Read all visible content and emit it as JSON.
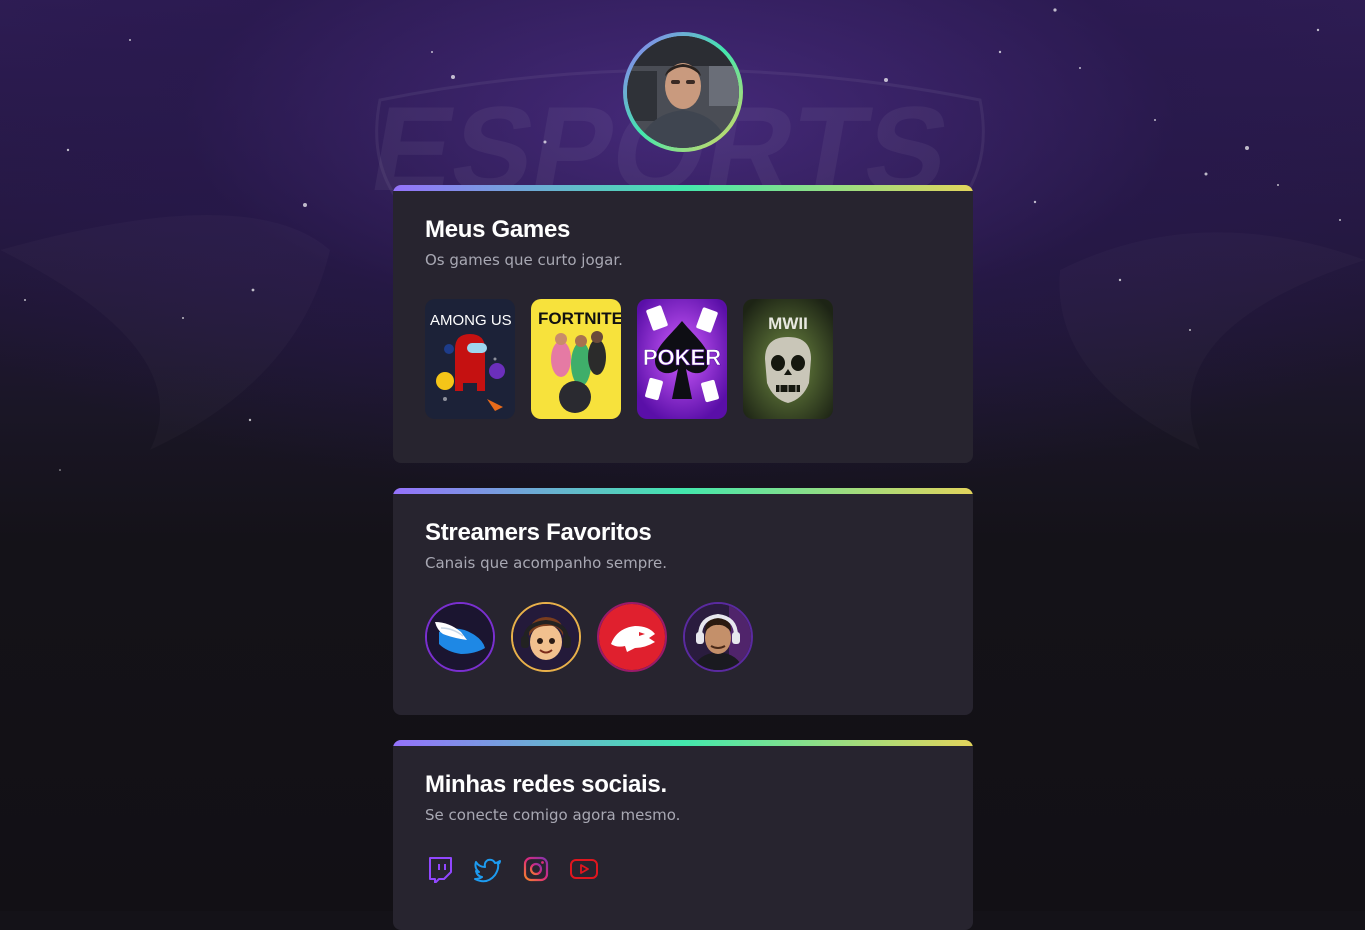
{
  "profile": {
    "avatar_alt": "profile photo"
  },
  "games_section": {
    "title": "Meus Games",
    "subtitle": "Os games que curto jogar.",
    "games": [
      {
        "name": "AMONG US"
      },
      {
        "name": "FORTNITE"
      },
      {
        "name": "POKER"
      },
      {
        "name": "MWII"
      }
    ]
  },
  "streamers_section": {
    "title": "Streamers Favoritos",
    "subtitle": "Canais que acompanho sempre.",
    "streamers": [
      {
        "icon": "winged-logo-icon"
      },
      {
        "icon": "cartoon-avatar-icon"
      },
      {
        "icon": "panther-logo-icon"
      },
      {
        "icon": "streamer-photo-icon"
      }
    ]
  },
  "social_section": {
    "title": "Minhas redes sociais.",
    "subtitle": "Se conecte comigo agora mesmo.",
    "links": [
      {
        "icon": "twitch-icon",
        "color": "#9147ff"
      },
      {
        "icon": "twitter-icon",
        "color": "#1d9bf0"
      },
      {
        "icon": "instagram-icon",
        "color": "#e1306c"
      },
      {
        "icon": "youtube-icon",
        "color": "#ff0000"
      }
    ]
  },
  "colors": {
    "gradient": [
      "#9572fc",
      "#43e7ad",
      "#e2d45c"
    ],
    "card_bg": "#27242f",
    "page_bg": "#141218"
  }
}
